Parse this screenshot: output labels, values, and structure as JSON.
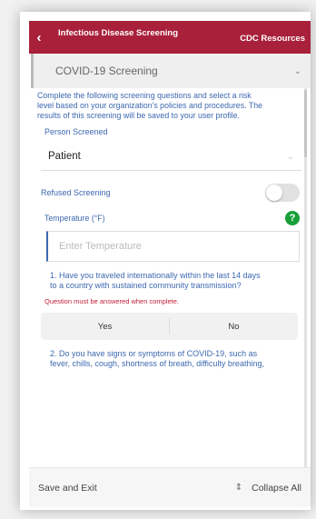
{
  "header": {
    "back_icon": "chevron-left-icon",
    "title": "Infectious Disease Screening",
    "link_label": "CDC Resources"
  },
  "accordion": {
    "title": "COVID-19 Screening",
    "chevron_icon": "chevron-down-icon"
  },
  "intro_text": "Complete the following screening questions and select a risk level based on your organization's policies and procedures. The results of this screening will be saved to your user profile.",
  "person_screened": {
    "label": "Person Screened",
    "value": "Patient",
    "chevron_icon": "chevron-down-icon"
  },
  "refused": {
    "label": "Refused Screening",
    "on": false
  },
  "temperature": {
    "label": "Temperature (°F)",
    "placeholder": "Enter Temperature",
    "help_icon": "question-icon"
  },
  "question1": {
    "text": "1. Have you traveled internationally within the last 14 days to a country with sustained community transmission?",
    "error": "Question must be answered when complete.",
    "yes_label": "Yes",
    "no_label": "No"
  },
  "question2": {
    "text": "2. Do you have signs or symptoms of COVID-19, such as fever, chills, cough, shortness of breath, difficulty breathing,"
  },
  "footer": {
    "save_label": "Save and Exit",
    "collapse_label": "Collapse All",
    "collapse_icon": "collapse-arrows-icon"
  },
  "colors": {
    "header_bg": "#a9203b",
    "text_blue": "#3d68b0",
    "help_green": "#17a03a",
    "error_red": "#c11d33"
  }
}
